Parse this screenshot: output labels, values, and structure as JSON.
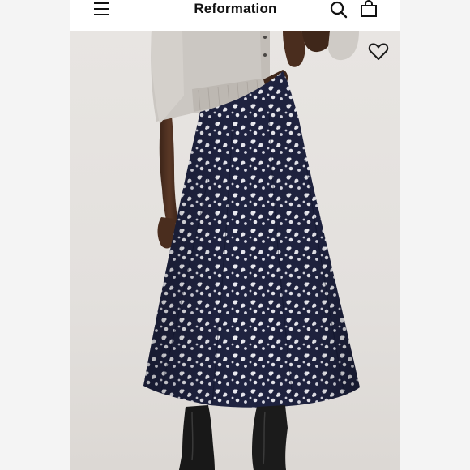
{
  "header": {
    "brand": "Reformation"
  },
  "icons": {
    "menu": "menu-icon",
    "search": "search-icon",
    "bag": "bag-icon",
    "wishlist": "heart-icon"
  },
  "colors": {
    "background": "#f4f4f4",
    "header_bg": "#ffffff",
    "photo_bg": "#e4e1de",
    "skirt": "#1f2340",
    "cardigan": "#cfcbc6"
  }
}
